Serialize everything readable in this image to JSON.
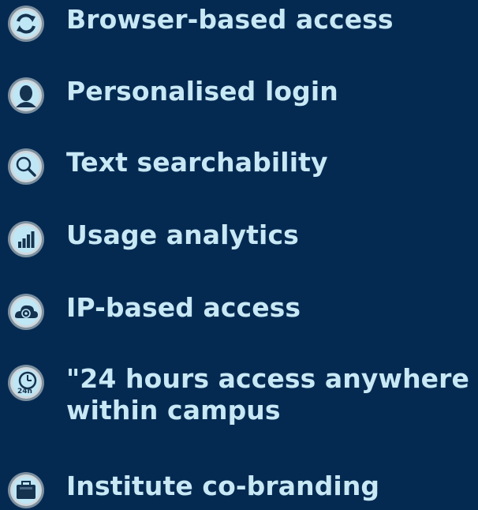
{
  "features": [
    {
      "icon": "refresh-icon",
      "label": "Browser-based access"
    },
    {
      "icon": "user-silhouette-icon",
      "label": "Personalised login"
    },
    {
      "icon": "magnifier-icon",
      "label": "Text searchability"
    },
    {
      "icon": "bar-chart-icon",
      "label": "Usage analytics"
    },
    {
      "icon": "at-cloud-icon",
      "label": "IP-based access"
    },
    {
      "icon": "clock-24h-icon",
      "label": "\"24 hours access anywhere\nwithin campus"
    },
    {
      "icon": "briefcase-icon",
      "label": "Institute co-branding"
    }
  ],
  "colors": {
    "background": "#052a52",
    "text": "#c7e8f4",
    "icon_fill": "#bfe6f4",
    "icon_ring": "#7c8f9e",
    "icon_dark": "#15324f"
  }
}
